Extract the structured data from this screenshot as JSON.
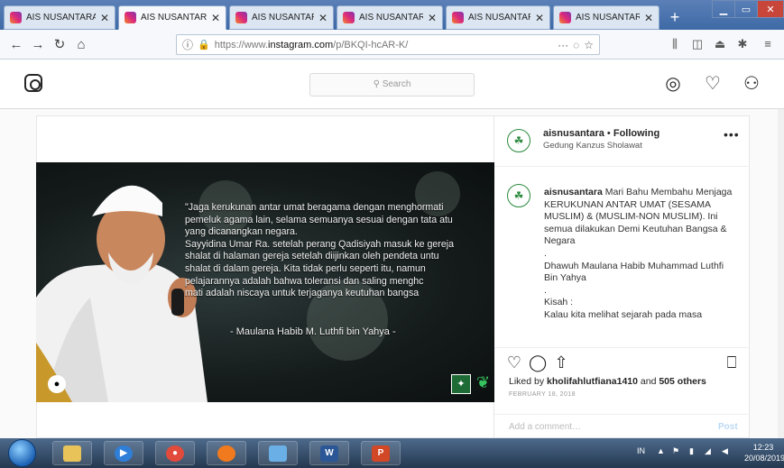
{
  "browser": {
    "tabs": [
      {
        "label": "AIS NUSANTARA"
      },
      {
        "label": "AIS NUSANTARA"
      },
      {
        "label": "AIS NUSANTARA"
      },
      {
        "label": "AIS NUSANTARA"
      },
      {
        "label": "AIS NUSANTARA"
      },
      {
        "label": "AIS NUSANTARA"
      }
    ],
    "active_tab_index": 1,
    "url_prefix": "https://www.",
    "url_domain": "instagram.com",
    "url_path": "/p/BKQI-hcAR-K/",
    "url_more": "···"
  },
  "instagram": {
    "search_placeholder": "Search",
    "post": {
      "username": "aisnusantara",
      "separator": " • ",
      "follow_status": "Following",
      "location": "Gedung Kanzus Sholawat",
      "caption_user": "aisnusantara",
      "caption_text": " Mari Bahu Membahu Menjaga KERUKUNAN ANTAR UMAT (SESAMA MUSLIM) & (MUSLIM-NON MUSLIM). Ini semua dilakukan Demi Keutuhan Bangsa & Negara\n.\nDhawuh Maulana Habib Muhammad Luthfi Bin Yahya\n.\nKisah :\nKalau kita melihat sejarah pada masa",
      "likes_prefix": "Liked by ",
      "likes_user": "kholifahlutfiana1410",
      "likes_middle": " and ",
      "likes_count": "505 others",
      "date": "FEBRUARY 18, 2018",
      "comment_placeholder": "Add a comment…",
      "post_label": "Post",
      "image_quote": "\"Jaga kerukunan antar umat beragama dengan menghormati\npemeluk agama lain, selama semuanya sesuai dengan tata atu\nyang dicanangkan negara.\nSayyidina Umar Ra. setelah perang Qadisiyah masuk ke gereja\nshalat di halaman gereja setelah diijinkan oleh pendeta untu\nshalat di dalam gereja. Kita tidak perlu seperti itu, namun\npelajarannya adalah bahwa toleransi dan saling menghc\nmati adalah niscaya untuk terjaganya keutuhan bangsa",
      "image_quote_author": "- Maulana Habib M. Luthfi bin Yahya -"
    }
  },
  "taskbar": {
    "apps": [
      {
        "icon": "file-explorer-icon",
        "color": "#e8c35a"
      },
      {
        "icon": "media-player-icon",
        "color": "#2f7ed8"
      },
      {
        "icon": "chrome-icon",
        "color": "#e24b3b"
      },
      {
        "icon": "firefox-icon",
        "color": "#f07a1d"
      },
      {
        "icon": "network-icon",
        "color": "#6ab0e6"
      },
      {
        "icon": "word-icon",
        "color": "#2b5797",
        "label": "W"
      },
      {
        "icon": "powerpoint-icon",
        "color": "#d24726",
        "label": "P"
      }
    ],
    "language": "IN",
    "time": "12:23",
    "date": "20/08/2019"
  },
  "colors": {
    "accent": "#3897f0",
    "ig_border": "#dbdbdb",
    "brand_green": "#2c8a3f"
  }
}
